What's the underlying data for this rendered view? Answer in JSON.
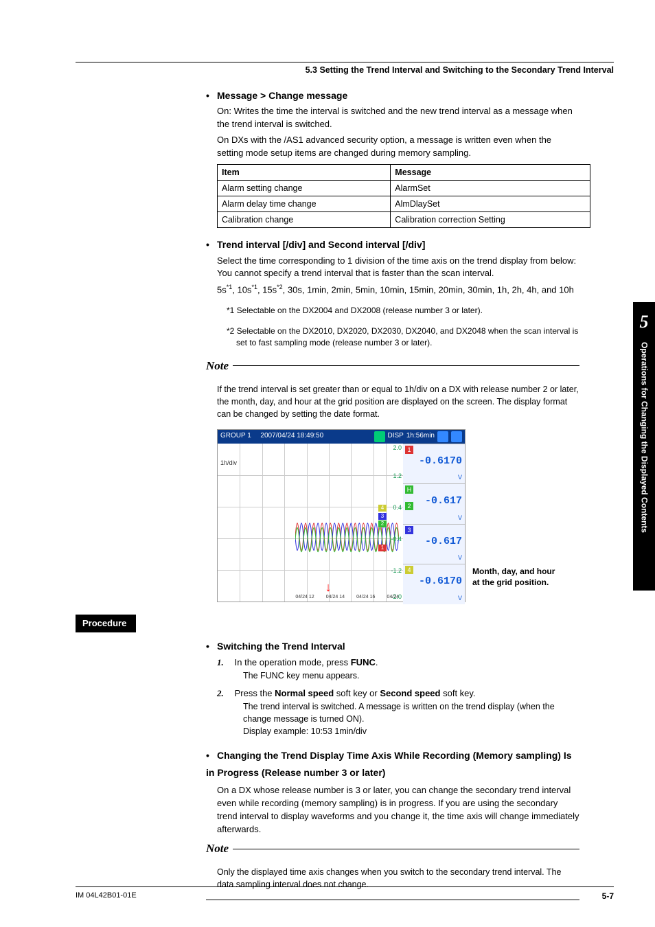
{
  "runningHead": "5.3  Setting the Trend Interval and Switching to the Secondary Trend Interval",
  "sideTab": {
    "chapter": "5",
    "title": "Operations for Changing the Displayed Contents"
  },
  "sec1": {
    "title": "Message > Change message",
    "p1": "On:   Writes the time the interval is switched and the new trend interval as a message when the trend interval is switched.",
    "p2": "On DXs with the /AS1 advanced security option, a message is written even when the setting mode setup items are changed during memory sampling."
  },
  "table": {
    "h1": "Item",
    "h2": "Message",
    "rows": [
      [
        "Alarm setting change",
        "AlarmSet"
      ],
      [
        "Alarm delay time change",
        "AlmDlaySet"
      ],
      [
        "Calibration change",
        "Calibration correction Setting"
      ]
    ]
  },
  "sec2": {
    "title": "Trend interval [/div] and Second interval [/div]",
    "p1": "Select the time corresponding to 1 division of the time axis on the trend display from below: You cannot specify a trend interval that is faster than the scan interval.",
    "p2a": "5s",
    "p2b": ", 10s",
    "p2c": ", 15s",
    "p2d": ", 30s, 1min, 2min, 5min, 10min, 15min, 20min, 30min, 1h, 2h, 4h, and 10h",
    "f1": "*1  Selectable on the DX2004 and DX2008 (release number 3 or later).",
    "f2": "*2  Selectable on the DX2010, DX2020, DX2030, DX2040, and DX2048 when the scan interval is set to fast sampling mode (release number 3 or later)."
  },
  "note1": {
    "label": "Note",
    "body": "If the trend interval is set greater than or equal to 1h/div on a DX with release number 2 or later, the month, day, and hour at the grid position are displayed on the screen. The display format can be changed by setting the date format."
  },
  "fig": {
    "group": "GROUP 1",
    "ts": "2007/04/24 18:49:50",
    "disp": "DISP",
    "dur": "1h:56min",
    "div": "1h/div",
    "vals": [
      "-0.6170",
      "-0.617",
      "-0.617",
      "-0.6170"
    ],
    "unit": "V",
    "H": "H",
    "yticks": [
      "2.0",
      "1.2",
      "0.4",
      "-0.4",
      "-1.2",
      "-2.0"
    ],
    "xlabs": [
      "04/24 12",
      "04/24 14",
      "04/24 16",
      "04/24"
    ],
    "caption1": "Month, day, and hour",
    "caption2": "at the grid position."
  },
  "procLabel": "Procedure",
  "proc1": {
    "title": "Switching the Trend Interval",
    "s1a": "In the operation mode, press ",
    "s1b": "FUNC",
    "s1c": ".",
    "s1sub": "The FUNC key menu appears.",
    "s2a": "Press the ",
    "s2b": "Normal speed",
    "s2c": " soft key or ",
    "s2d": "Second speed",
    "s2e": " soft key.",
    "s2sub1": "The trend interval is switched. A message is written on the trend display (when the change message is turned ON).",
    "s2sub2": "Display example: 10:53 1min/div"
  },
  "proc2": {
    "title": "Changing the Trend Display Time Axis While Recording (Memory sampling) Is in Progress (Release number 3 or later)",
    "body": "On a DX whose release number is 3 or later, you can change the secondary trend interval even while recording (memory sampling) is in progress. If you are using the secondary trend interval to display waveforms and you change it, the time axis will change immediately afterwards."
  },
  "note2": {
    "label": "Note",
    "body": "Only the displayed time axis changes when you switch to the secondary trend interval. The data sampling interval does not change."
  },
  "footer": {
    "left": "IM 04L42B01-01E",
    "right": "5-7"
  }
}
